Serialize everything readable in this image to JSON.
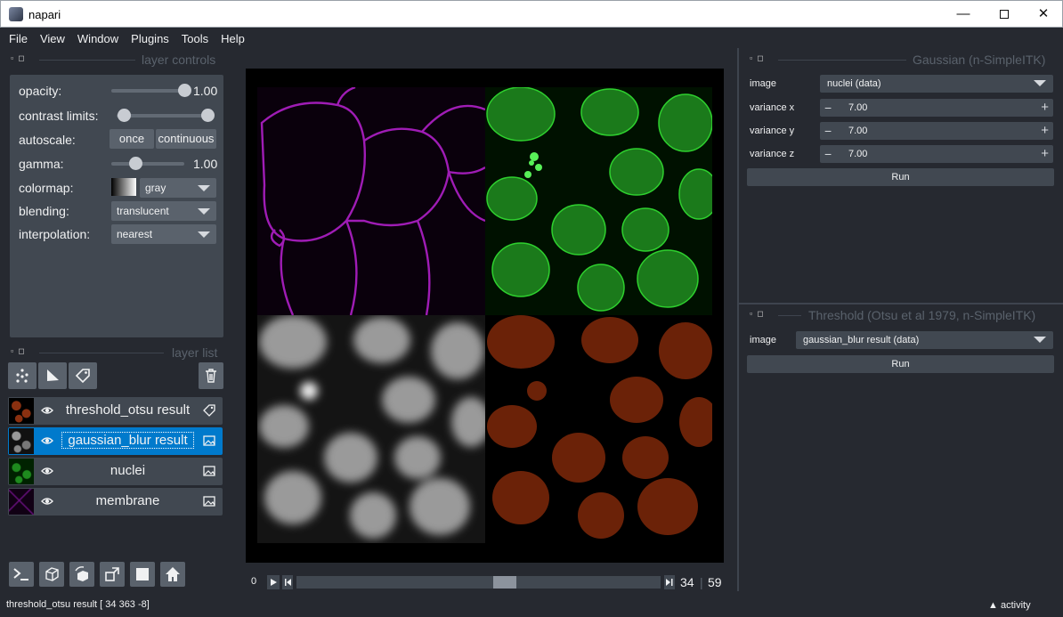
{
  "window": {
    "title": "napari",
    "minimize": "—",
    "close": "✕"
  },
  "menu": [
    "File",
    "View",
    "Window",
    "Plugins",
    "Tools",
    "Help"
  ],
  "layer_controls": {
    "header": "layer controls",
    "opacity": {
      "label": "opacity:",
      "value": "1.00",
      "level": 1.0
    },
    "contrast": {
      "label": "contrast limits:",
      "range": [
        0.0,
        1.0
      ]
    },
    "autoscale": {
      "label": "autoscale:",
      "once": "once",
      "continuous": "continuous"
    },
    "gamma": {
      "label": "gamma:",
      "value": "1.00",
      "level": 0.33
    },
    "colormap": {
      "label": "colormap:",
      "value": "gray"
    },
    "blending": {
      "label": "blending:",
      "value": "translucent"
    },
    "interpolation": {
      "label": "interpolation:",
      "value": "nearest"
    }
  },
  "layer_list": {
    "header": "layer list",
    "layers": [
      {
        "name": "threshold_otsu result",
        "type": "labels",
        "selected": false
      },
      {
        "name": "gaussian_blur result",
        "type": "image",
        "selected": true
      },
      {
        "name": "nuclei",
        "type": "image",
        "selected": false
      },
      {
        "name": "membrane",
        "type": "image",
        "selected": false
      }
    ]
  },
  "dims": {
    "start": "0",
    "current": "34",
    "max": "59",
    "level": 0.576
  },
  "gaussian_dock": {
    "header": "Gaussian (n-SimpleITK)",
    "image_label": "image",
    "image_value": "nuclei (data)",
    "variance_x": {
      "label": "variance x",
      "value": "7.00"
    },
    "variance_y": {
      "label": "variance y",
      "value": "7.00"
    },
    "variance_z": {
      "label": "variance z",
      "value": "7.00"
    },
    "run": "Run"
  },
  "threshold_dock": {
    "header": "Threshold (Otsu et al 1979, n-SimpleITK)",
    "image_label": "image",
    "image_value": "gaussian_blur result (data)",
    "run": "Run"
  },
  "status": {
    "text": "threshold_otsu result [ 34 363  -8]",
    "activity": "activity"
  },
  "colors": {
    "background": "#262930",
    "panel": "#414851",
    "control": "#5a626c",
    "selection": "#007acc",
    "membrane": "#b020c8",
    "nuclei": "#2ed02e",
    "labels": "#6b2208"
  }
}
